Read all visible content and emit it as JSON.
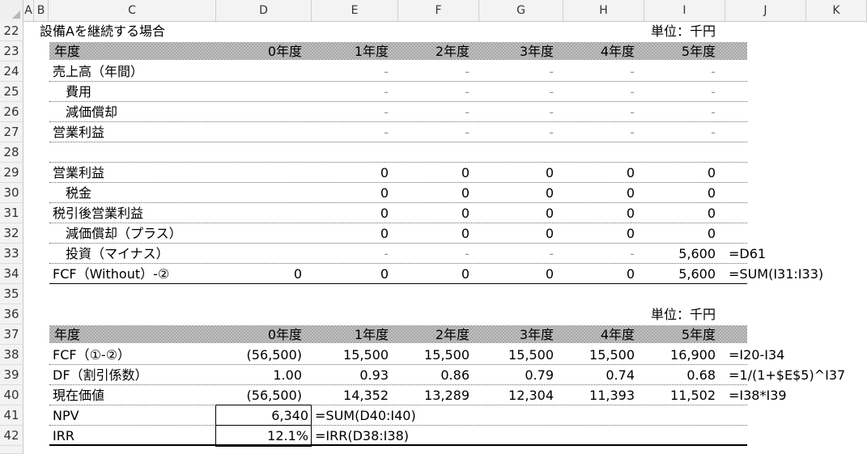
{
  "columns": [
    "A",
    "B",
    "C",
    "D",
    "E",
    "F",
    "G",
    "H",
    "I",
    "J",
    "K"
  ],
  "section1": {
    "title": "設備Aを継続する場合",
    "unit": "単位：千円",
    "header": {
      "label": "年度",
      "years": [
        "0年度",
        "1年度",
        "2年度",
        "3年度",
        "4年度",
        "5年度"
      ]
    },
    "rows": [
      {
        "num": "24",
        "label": "売上高（年間）",
        "vals": [
          "",
          "-",
          "-",
          "-",
          "-",
          "-"
        ]
      },
      {
        "num": "25",
        "label": "　費用",
        "vals": [
          "",
          "-",
          "-",
          "-",
          "-",
          "-"
        ]
      },
      {
        "num": "26",
        "label": "　減価償却",
        "vals": [
          "",
          "-",
          "-",
          "-",
          "-",
          "-"
        ]
      },
      {
        "num": "27",
        "label": "営業利益",
        "vals": [
          "",
          "-",
          "-",
          "-",
          "-",
          "-"
        ]
      },
      {
        "num": "28",
        "label": "",
        "vals": [
          "",
          "",
          "",
          "",
          "",
          ""
        ]
      },
      {
        "num": "29",
        "label": "営業利益",
        "vals": [
          "",
          "0",
          "0",
          "0",
          "0",
          "0"
        ]
      },
      {
        "num": "30",
        "label": "　税金",
        "vals": [
          "",
          "0",
          "0",
          "0",
          "0",
          "0"
        ]
      },
      {
        "num": "31",
        "label": "税引後営業利益",
        "vals": [
          "",
          "0",
          "0",
          "0",
          "0",
          "0"
        ]
      },
      {
        "num": "32",
        "label": "　減価償却（プラス）",
        "vals": [
          "",
          "0",
          "0",
          "0",
          "0",
          "0"
        ]
      },
      {
        "num": "33",
        "label": "　投資（マイナス）",
        "vals": [
          "",
          "-",
          "-",
          "-",
          "-",
          "5,600"
        ],
        "formula": "=D61"
      },
      {
        "num": "34",
        "label": "FCF（Without）-②",
        "vals": [
          "0",
          "0",
          "0",
          "0",
          "0",
          "5,600"
        ],
        "formula": "=SUM(I31:I33)"
      }
    ]
  },
  "section2": {
    "unit": "単位：千円",
    "header": {
      "label": "年度",
      "years": [
        "0年度",
        "1年度",
        "2年度",
        "3年度",
        "4年度",
        "5年度"
      ]
    },
    "rows": [
      {
        "num": "38",
        "label": "FCF（①-②）",
        "vals": [
          "(56,500)",
          "15,500",
          "15,500",
          "15,500",
          "15,500",
          "16,900"
        ],
        "formula": "=I20-I34"
      },
      {
        "num": "39",
        "label": "DF（割引係数）",
        "vals": [
          "1.00",
          "0.93",
          "0.86",
          "0.79",
          "0.74",
          "0.68"
        ],
        "formula": "=1/(1+$E$5)^I37"
      },
      {
        "num": "40",
        "label": "現在価値",
        "vals": [
          "(56,500)",
          "14,352",
          "13,289",
          "12,304",
          "11,393",
          "11,502"
        ],
        "formula": "=I38*I39"
      }
    ],
    "npv": {
      "label": "NPV",
      "value": "6,340",
      "formula": "=SUM(D40:I40)"
    },
    "irr": {
      "label": "IRR",
      "value": "12.1%",
      "formula": "=IRR(D38:I38)"
    }
  },
  "row_numbers": [
    "22",
    "23",
    "24",
    "25",
    "26",
    "27",
    "28",
    "29",
    "30",
    "31",
    "32",
    "33",
    "34",
    "35",
    "36",
    "37",
    "38",
    "39",
    "40",
    "41",
    "42"
  ]
}
